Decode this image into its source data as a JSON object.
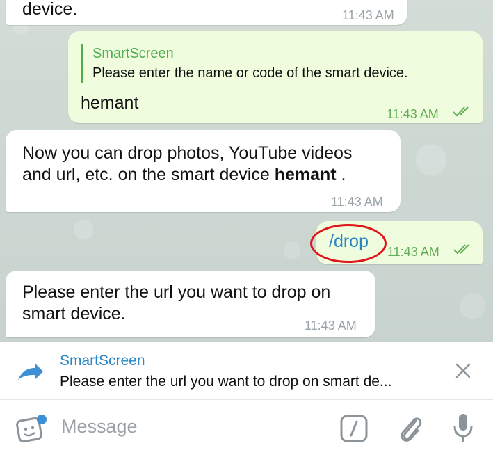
{
  "messages": {
    "m0": {
      "text": "device.",
      "time": "11:43 AM"
    },
    "m1": {
      "quote_name": "SmartScreen",
      "quote_text": "Please enter the name or code of the smart device.",
      "text": "hemant",
      "time": "11:43 AM"
    },
    "m2": {
      "line1": "Now you can drop photos, YouTube videos",
      "line2_prefix": "and url, etc. on the smart device ",
      "line2_bold": "hemant",
      "line2_suffix": " .",
      "time": "11:43 AM"
    },
    "m3": {
      "text": "/drop",
      "time": "11:43 AM"
    },
    "m4": {
      "line1": "Please enter the url you want to drop on",
      "line2": "smart device.",
      "time": "11:43 AM"
    }
  },
  "reply_bar": {
    "name": "SmartScreen",
    "text": "Please enter the url you want to drop on smart de...",
    "icon": "reply-arrow-icon",
    "close_icon": "close-icon"
  },
  "input": {
    "placeholder": "Message",
    "icons": [
      "sticker-icon",
      "bot-command-icon",
      "attach-icon",
      "mic-icon"
    ]
  },
  "colors": {
    "accent": "#2a85c4",
    "outgoing_bubble": "#effdde",
    "outgoing_accent": "#4fae4e",
    "highlight_circle": "#e0141b"
  }
}
